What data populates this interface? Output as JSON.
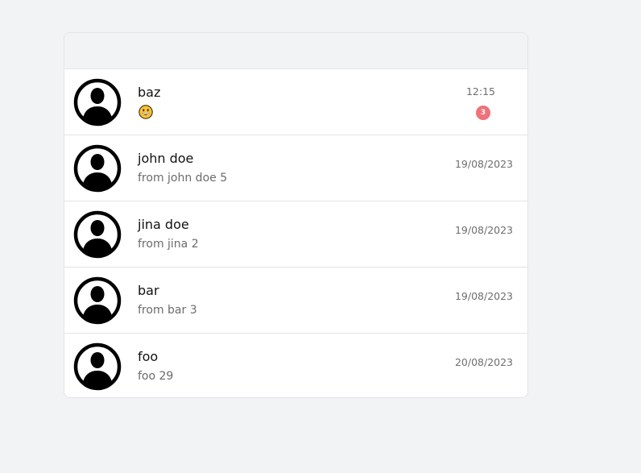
{
  "colors": {
    "page_background": "#f2f3f5",
    "badge": "#f07178"
  },
  "chats": [
    {
      "name": "baz",
      "preview": "",
      "preview_emoji": "grinning-face-icon",
      "time": "12:15",
      "unread": "3"
    },
    {
      "name": "john doe",
      "preview": "from john doe 5",
      "time": "19/08/2023"
    },
    {
      "name": "jina doe",
      "preview": "from jina 2",
      "time": "19/08/2023"
    },
    {
      "name": "bar",
      "preview": "from bar 3",
      "time": "19/08/2023"
    },
    {
      "name": "foo",
      "preview": "foo 29",
      "time": "20/08/2023"
    }
  ]
}
